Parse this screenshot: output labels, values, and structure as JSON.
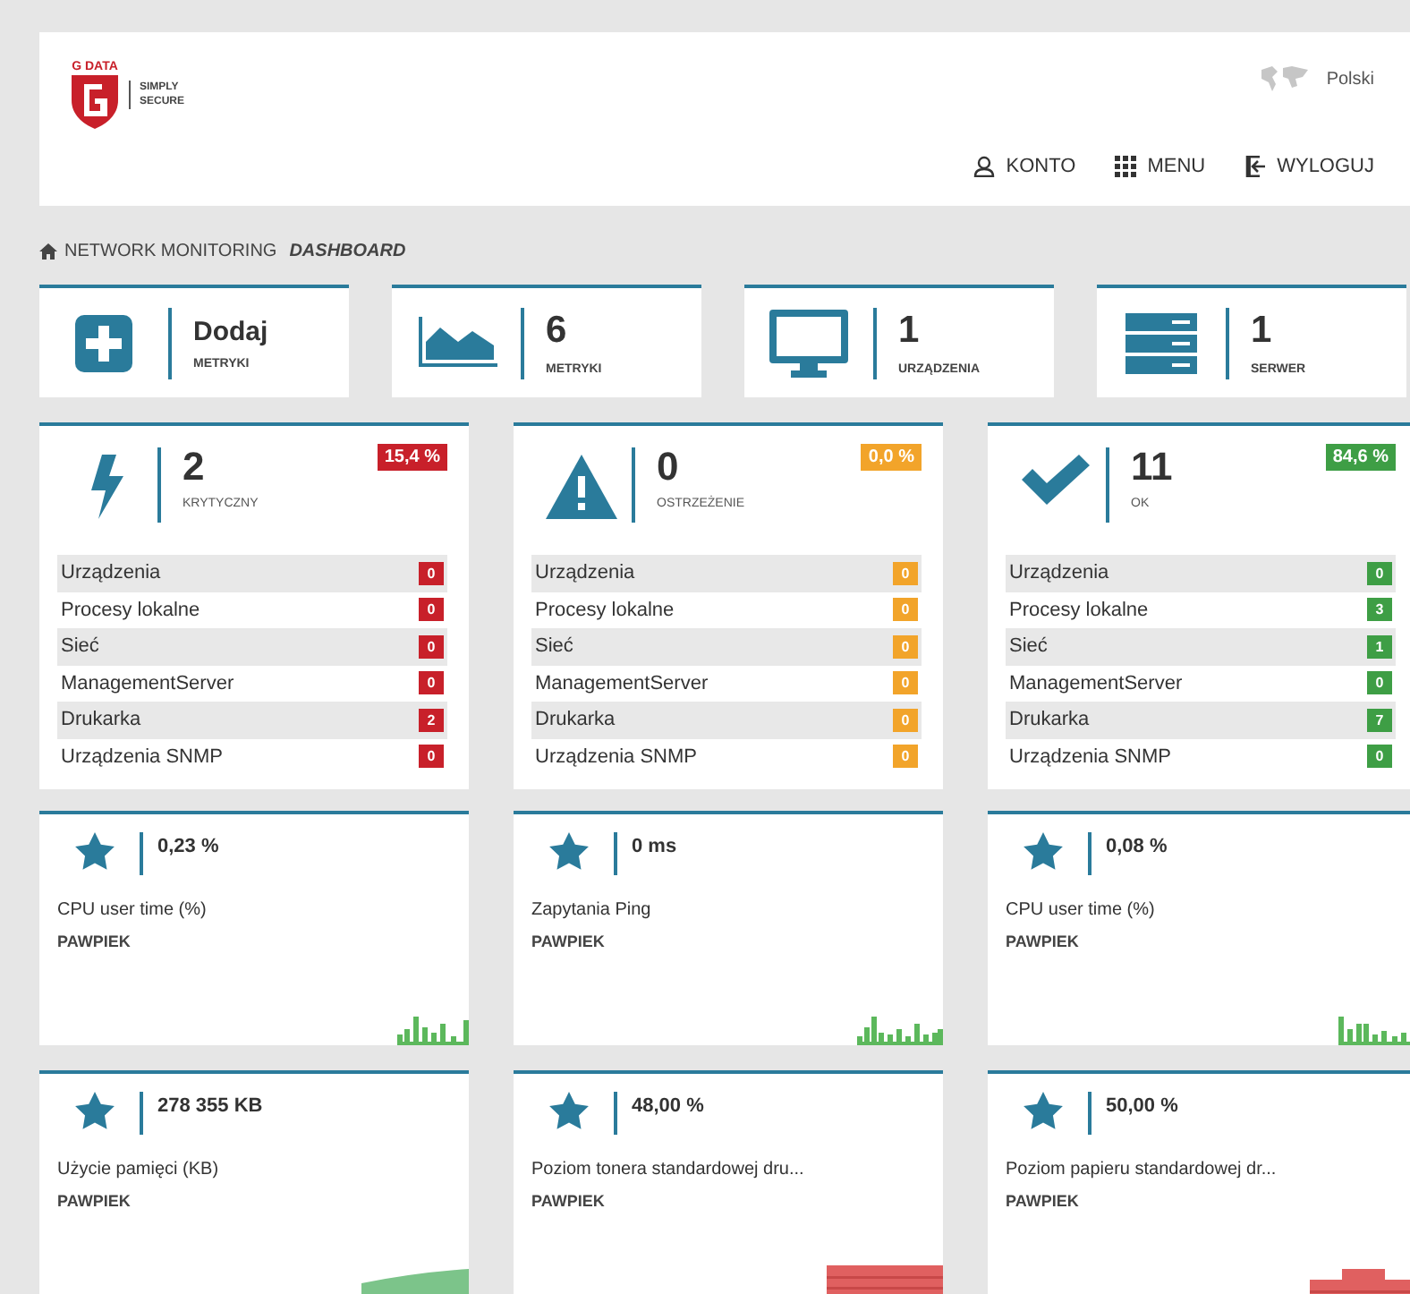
{
  "header": {
    "logo_top": "G DATA",
    "logo_tagline": [
      "SIMPLY",
      "SECURE"
    ],
    "language": "Polski",
    "nav": [
      {
        "kind": "account",
        "label": "KONTO"
      },
      {
        "kind": "menu",
        "label": "MENU"
      },
      {
        "kind": "logout",
        "label": "WYLOGUJ"
      }
    ]
  },
  "breadcrumb": {
    "section": "NETWORK MONITORING",
    "page": "DASHBOARD"
  },
  "summary": [
    {
      "kind": "add",
      "value": "Dodaj",
      "label": "METRYKI"
    },
    {
      "kind": "metrics",
      "value": "6",
      "label": "METRYKI"
    },
    {
      "kind": "devices",
      "value": "1",
      "label": "URZĄDZENIA"
    },
    {
      "kind": "servers",
      "value": "1",
      "label": "SERWER"
    }
  ],
  "status": [
    {
      "kind": "critical",
      "color": "#c8202a",
      "count": "2",
      "label": "KRYTYCZNY",
      "percent": "15,4 %",
      "rows": [
        {
          "name": "Urządzenia",
          "count": "0"
        },
        {
          "name": "Procesy lokalne",
          "count": "0"
        },
        {
          "name": "Sieć",
          "count": "0"
        },
        {
          "name": "ManagementServer",
          "count": "0"
        },
        {
          "name": "Drukarka",
          "count": "2"
        },
        {
          "name": "Urządzenia SNMP",
          "count": "0"
        }
      ]
    },
    {
      "kind": "warning",
      "color": "#f2a42a",
      "count": "0",
      "label": "OSTRZEŻENIE",
      "percent": "0,0 %",
      "rows": [
        {
          "name": "Urządzenia",
          "count": "0"
        },
        {
          "name": "Procesy lokalne",
          "count": "0"
        },
        {
          "name": "Sieć",
          "count": "0"
        },
        {
          "name": "ManagementServer",
          "count": "0"
        },
        {
          "name": "Drukarka",
          "count": "0"
        },
        {
          "name": "Urządzenia SNMP",
          "count": "0"
        }
      ]
    },
    {
      "kind": "ok",
      "color": "#3e9e45",
      "count": "11",
      "label": "OK",
      "percent": "84,6 %",
      "rows": [
        {
          "name": "Urządzenia",
          "count": "0"
        },
        {
          "name": "Procesy lokalne",
          "count": "3"
        },
        {
          "name": "Sieć",
          "count": "1"
        },
        {
          "name": "ManagementServer",
          "count": "0"
        },
        {
          "name": "Drukarka",
          "count": "7"
        },
        {
          "name": "Urządzenia SNMP",
          "count": "0"
        }
      ]
    }
  ],
  "metrics": [
    {
      "value": "0,23 %",
      "name": "CPU user time (%)",
      "host": "PAWPIEK",
      "kind": "spikes",
      "color": "#5cb85c"
    },
    {
      "value": "0 ms",
      "name": "Zapytania Ping",
      "host": "PAWPIEK",
      "kind": "spikes2",
      "color": "#5cb85c"
    },
    {
      "value": "0,08 %",
      "name": "CPU user time (%)",
      "host": "PAWPIEK",
      "kind": "spikes3",
      "color": "#5cb85c"
    },
    {
      "value": "278 355 KB",
      "name": "Użycie pamięci (KB)",
      "host": "PAWPIEK",
      "kind": "area",
      "color": "#7cc48a"
    },
    {
      "value": "48,00 %",
      "name": "Poziom tonera standardowej dru...",
      "host": "PAWPIEK",
      "kind": "block",
      "color": "#e06060"
    },
    {
      "value": "50,00 %",
      "name": "Poziom papieru standardowej dr...",
      "host": "PAWPIEK",
      "kind": "steps",
      "color": "#e06060"
    }
  ]
}
